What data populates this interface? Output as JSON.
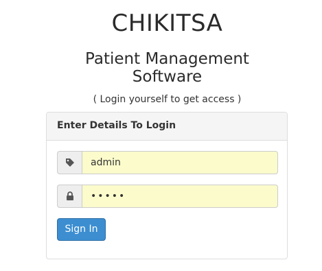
{
  "app": {
    "title": "CHIKITSA",
    "subtitle_line1": "Patient Management",
    "subtitle_line2": "Software",
    "tagline": "( Login yourself to get access )"
  },
  "login_panel": {
    "heading": "Enter Details To Login",
    "username": {
      "icon": "tag-icon",
      "value": "admin"
    },
    "password": {
      "icon": "lock-icon",
      "masked_value": "•••••"
    },
    "sign_in_label": "Sign In"
  },
  "colors": {
    "field_autofill_bg": "#fbfbcc",
    "primary_button": "#3c8ed1",
    "panel_heading_bg": "#f5f5f5"
  }
}
